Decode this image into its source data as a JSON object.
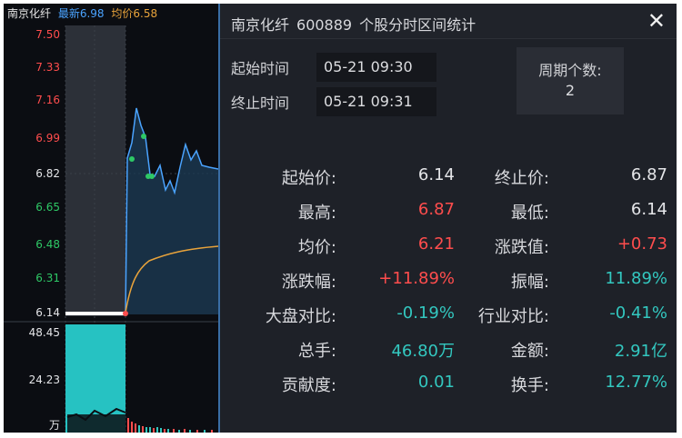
{
  "header": {
    "name": "南京化纤",
    "latest": "最新6.98",
    "avg": "均价6.58"
  },
  "price_axis": [
    "7.50",
    "7.33",
    "7.16",
    "6.99",
    "6.82",
    "6.65",
    "6.48",
    "6.31",
    "6.14"
  ],
  "volume_axis": {
    "top": "48.45",
    "mid": "24.23",
    "unit": "万"
  },
  "colors": {
    "up": "#ff4d4d",
    "down": "#33c8c0",
    "flat": "#e4e5e8",
    "avg_line": "#e8a33b",
    "price_line": "#4aa3ff",
    "accent": "#3a6ea5"
  },
  "panel": {
    "title": {
      "name": "南京化纤",
      "code": "600889",
      "label": "个股分时区间统计"
    },
    "close_icon": "✕",
    "start_label": "起始时间",
    "start_value": "05-21 09:30",
    "end_label": "终止时间",
    "end_value": "05-21 09:31",
    "periods_label": "周期个数:",
    "periods_value": "2"
  },
  "stats": [
    {
      "k1": "起始价:",
      "v1": "6.14",
      "c1": "white",
      "k2": "终止价:",
      "v2": "6.87",
      "c2": "white"
    },
    {
      "k1": "最高:",
      "v1": "6.87",
      "c1": "red",
      "k2": "最低:",
      "v2": "6.14",
      "c2": "white"
    },
    {
      "k1": "均价:",
      "v1": "6.21",
      "c1": "red",
      "k2": "涨跌值:",
      "v2": "+0.73",
      "c2": "red"
    },
    {
      "k1": "涨跌幅:",
      "v1": "+11.89%",
      "c1": "red",
      "k2": "振幅:",
      "v2": "11.89%",
      "c2": "cyan"
    },
    {
      "k1": "大盘对比:",
      "v1": "-0.19%",
      "c1": "cyan",
      "k2": "行业对比:",
      "v2": "-0.41%",
      "c2": "cyan"
    },
    {
      "k1": "总手:",
      "v1": "46.80万",
      "c1": "cyan",
      "k2": "金额:",
      "v2": "2.91亿",
      "c2": "cyan"
    },
    {
      "k1": "贡献度:",
      "v1": "0.01",
      "c1": "cyan",
      "k2": "换手:",
      "v2": "12.77%",
      "c2": "cyan"
    }
  ]
}
